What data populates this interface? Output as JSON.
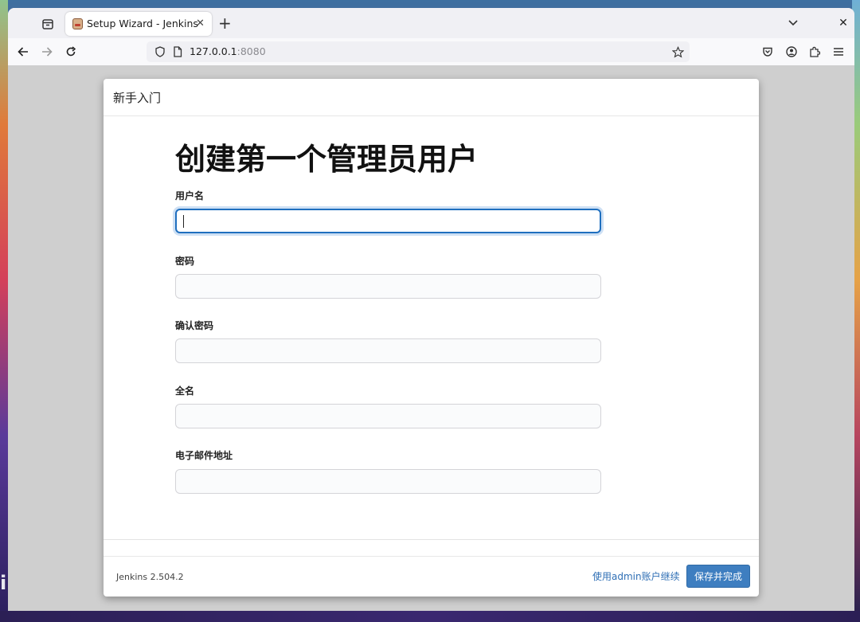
{
  "browser": {
    "tab_title": "Setup Wizard - Jenkins",
    "url_host": "127.0.0.1",
    "url_port": ":8080"
  },
  "dialog": {
    "header": "新手入门",
    "title": "创建第一个管理员用户",
    "fields": [
      {
        "label": "用户名",
        "value": "",
        "placeholder": ""
      },
      {
        "label": "密码",
        "value": "",
        "placeholder": ""
      },
      {
        "label": "确认密码",
        "value": "",
        "placeholder": ""
      },
      {
        "label": "全名",
        "value": "",
        "placeholder": ""
      },
      {
        "label": "电子邮件地址",
        "value": "",
        "placeholder": ""
      }
    ],
    "footer": {
      "version": "Jenkins 2.504.2",
      "skip_link": "使用admin账户继续",
      "save_button": "保存并完成"
    }
  },
  "desktop": {
    "edge_letter": "i"
  },
  "colors": {
    "accent": "#3e7ec0",
    "link": "#2f6fb5",
    "focus_ring": "#1f6fbf"
  }
}
